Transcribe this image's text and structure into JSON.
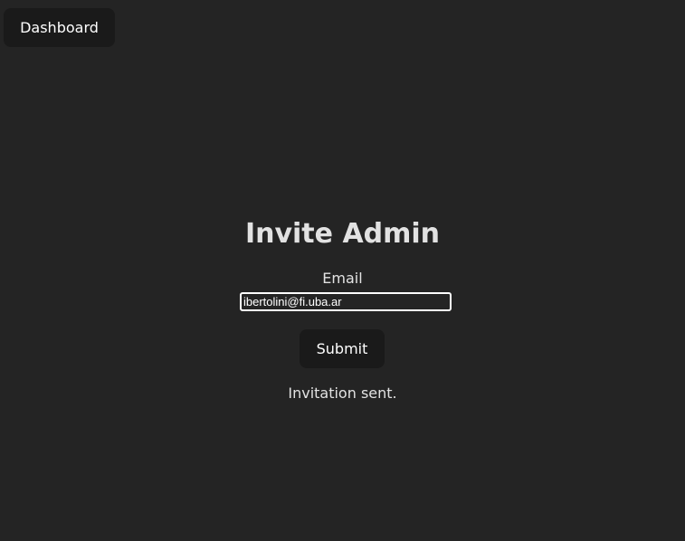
{
  "nav": {
    "dashboard_label": "Dashboard"
  },
  "form": {
    "title": "Invite Admin",
    "email_label": "Email",
    "email_value": "ibertolini@fi.uba.ar",
    "submit_label": "Submit",
    "status_message": "Invitation sent."
  },
  "colors": {
    "background": "#242424",
    "button_background": "#1a1a1a",
    "text": "#ffffff"
  }
}
